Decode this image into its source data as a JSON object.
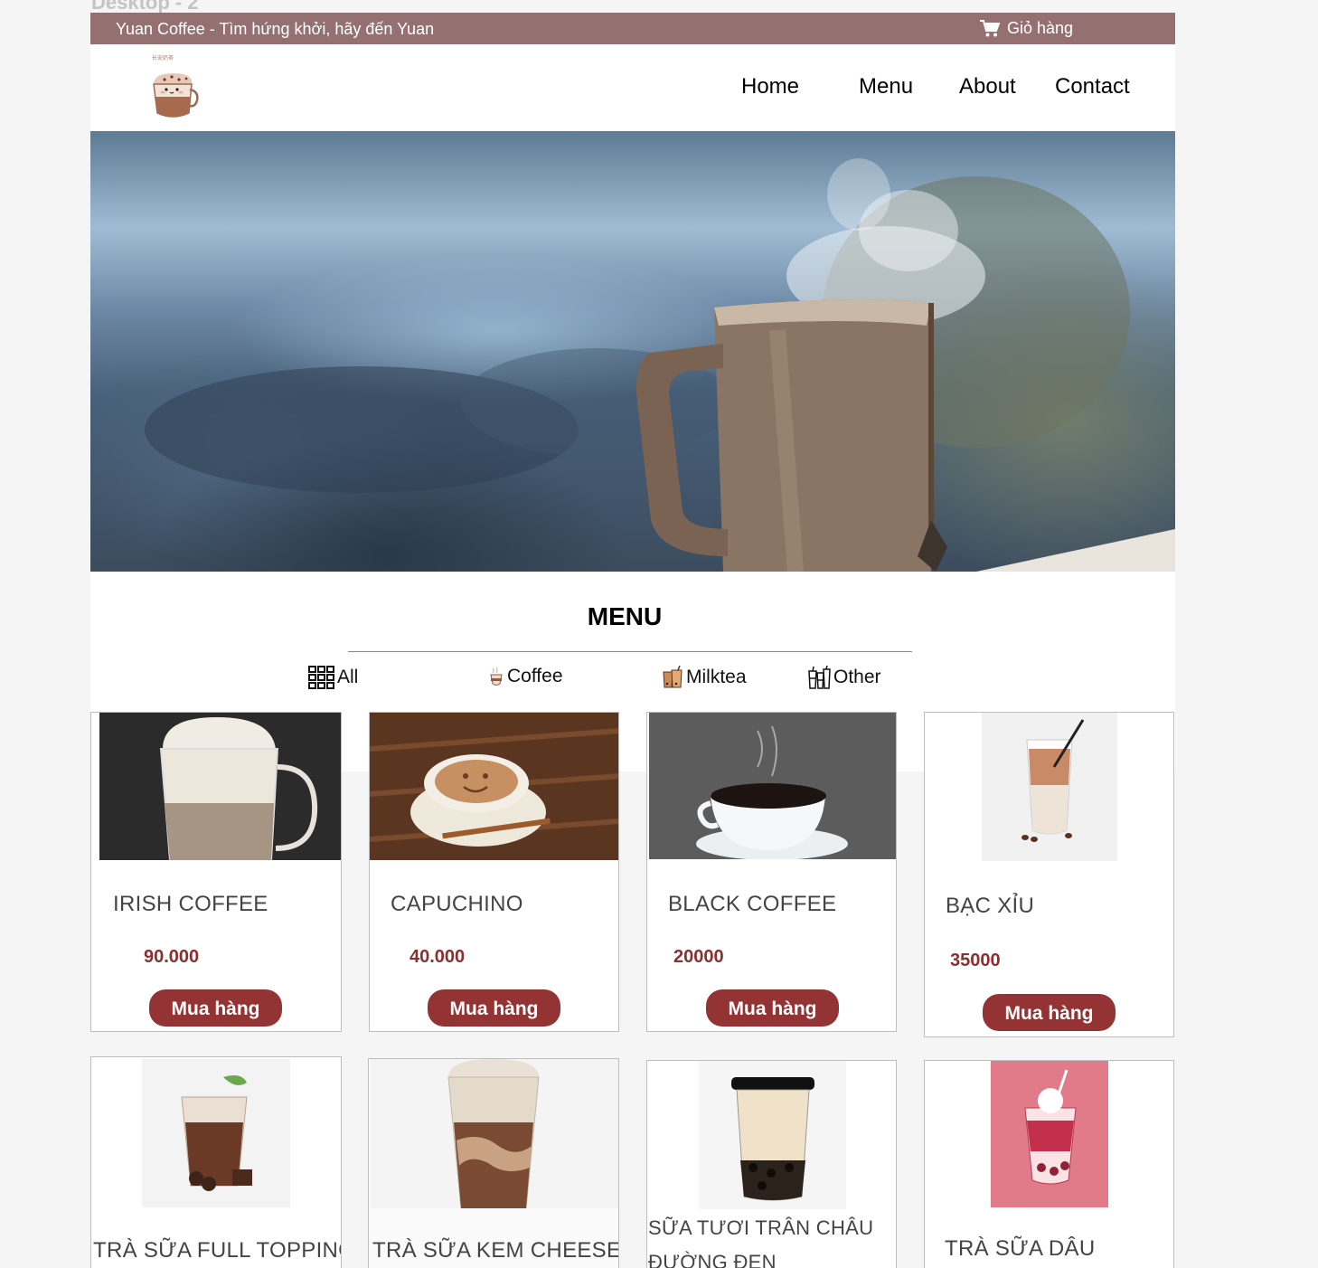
{
  "frame": {
    "label": "Desktop - 2"
  },
  "topbar": {
    "tagline": "Yuan Coffee - Tìm hứng khởi, hãy đến Yuan",
    "cart_label": "Giỏ hàng",
    "cart_icon": "shopping-cart-icon"
  },
  "logo": {
    "alt": "Yuan Coffee logo",
    "mark_text": "长安奶茶"
  },
  "nav": {
    "items": [
      "Home",
      "Menu",
      "About",
      "Contact"
    ]
  },
  "hero": {
    "description_icon": "steaming-mug-image"
  },
  "menu": {
    "title": "MENU",
    "categories": [
      {
        "label": "All",
        "icon": "grid-icon"
      },
      {
        "label": "Coffee",
        "icon": "coffee-cup-icon"
      },
      {
        "label": "Milktea",
        "icon": "milktea-icon"
      },
      {
        "label": "Other",
        "icon": "other-drinks-icon"
      }
    ]
  },
  "products": [
    {
      "name": "IRISH COFFEE",
      "price": "90.000",
      "button": "Mua hàng"
    },
    {
      "name": "CAPUCHINO",
      "price": "40.000",
      "button": "Mua hàng"
    },
    {
      "name": "BLACK COFFEE",
      "price": "20000",
      "button": "Mua hàng"
    },
    {
      "name": "BẠC XỈU",
      "price": "35000",
      "button": "Mua hàng"
    },
    {
      "name": "TRÀ SỮA FULL TOPPING"
    },
    {
      "name": "TRÀ SỮA KEM CHEESE"
    },
    {
      "name": "SỮA TƯƠI TRÂN CHÂU",
      "name_line2": "ĐƯỜNG ĐEN"
    },
    {
      "name": "TRÀ SỮA DÂU"
    }
  ],
  "colors": {
    "topbar": "#957070",
    "accent": "#943333",
    "price": "#8b2f2f"
  }
}
